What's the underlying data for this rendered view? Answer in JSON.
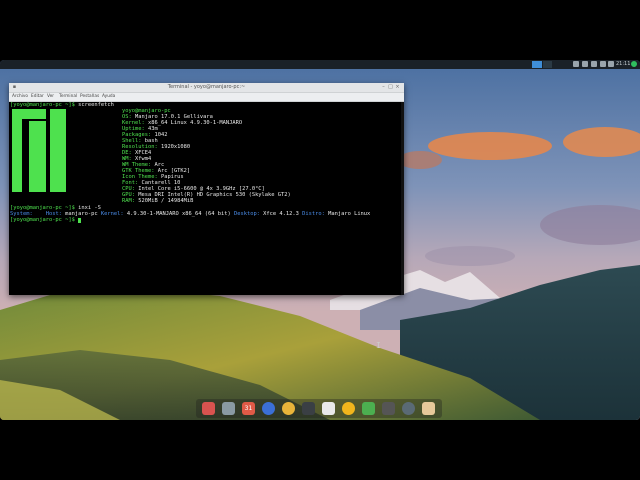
{
  "window": {
    "title": "Terminal - yoyo@manjaro-pc:~",
    "menus": [
      "Archivo",
      "Editar",
      "Ver",
      "Terminal",
      "Pestañas",
      "Ayuda"
    ]
  },
  "top_panel": {
    "clock": "21:11",
    "tray_icons": [
      "bluetooth-icon",
      "network-icon",
      "volume-icon",
      "battery-icon",
      "notes-icon"
    ]
  },
  "terminal": {
    "prompt1": "[yoyo@manjaro-pc ~]$",
    "cmd1": " screenfetch",
    "info": [
      {
        "key": "",
        "val": "yoyo@manjaro-pc"
      },
      {
        "key": "OS:",
        "val": " Manjaro 17.0.1 Gellivara"
      },
      {
        "key": "Kernel:",
        "val": " x86_64 Linux 4.9.30-1-MANJARO"
      },
      {
        "key": "Uptime:",
        "val": " 43m"
      },
      {
        "key": "Packages:",
        "val": " 1042"
      },
      {
        "key": "Shell:",
        "val": " bash"
      },
      {
        "key": "Resolution:",
        "val": " 1920x1080"
      },
      {
        "key": "DE:",
        "val": " XFCE4"
      },
      {
        "key": "WM:",
        "val": " Xfwm4"
      },
      {
        "key": "WM Theme:",
        "val": " Arc"
      },
      {
        "key": "GTK Theme:",
        "val": " Arc [GTK2]"
      },
      {
        "key": "Icon Theme:",
        "val": " Papirus"
      },
      {
        "key": "Font:",
        "val": " Cantarell 10"
      },
      {
        "key": "CPU:",
        "val": " Intel Core i5-6600 @ 4x 3.9GHz [27.0°C]"
      },
      {
        "key": "GPU:",
        "val": " Mesa DRI Intel(R) HD Graphics 530 (Skylake GT2)"
      },
      {
        "key": "RAM:",
        "val": " 520MiB / 14984MiB"
      }
    ],
    "prompt2": "[yoyo@manjaro-pc ~]$",
    "cmd2": " inxi -S",
    "inxi": {
      "system_label": "System:",
      "host_label": "Host:",
      "host_val": " manjaro-pc ",
      "kernel_label": "Kernel:",
      "kernel_val": " 4.9.30-1-MANJARO x86_64 (64 bit) ",
      "desktop_label": "Desktop:",
      "desktop_val": " Xfce 4.12.3 ",
      "distro_label": "Distro:",
      "distro_val": " Manjaro Linux"
    },
    "prompt3": "[yoyo@manjaro-pc ~]$"
  },
  "dock": {
    "items": [
      {
        "name": "app-grid-icon",
        "color": "#d9534f"
      },
      {
        "name": "file-manager-icon",
        "color": "#8a9aa3"
      },
      {
        "name": "calendar-icon",
        "color": "#e05a47",
        "label": "31"
      },
      {
        "name": "firefox-icon",
        "color": "#3b6fd6"
      },
      {
        "name": "chrome-icon",
        "color": "#e8b43a"
      },
      {
        "name": "terminal-icon",
        "color": "#3a3f44"
      },
      {
        "name": "text-editor-icon",
        "color": "#e9e9e9"
      },
      {
        "name": "media-player-icon",
        "color": "#f1b51c"
      },
      {
        "name": "play-icon",
        "color": "#4caf50"
      },
      {
        "name": "inkscape-icon",
        "color": "#555"
      },
      {
        "name": "web-browser-icon",
        "color": "#5a6a75"
      },
      {
        "name": "download-icon",
        "color": "#e6c99a"
      }
    ]
  }
}
